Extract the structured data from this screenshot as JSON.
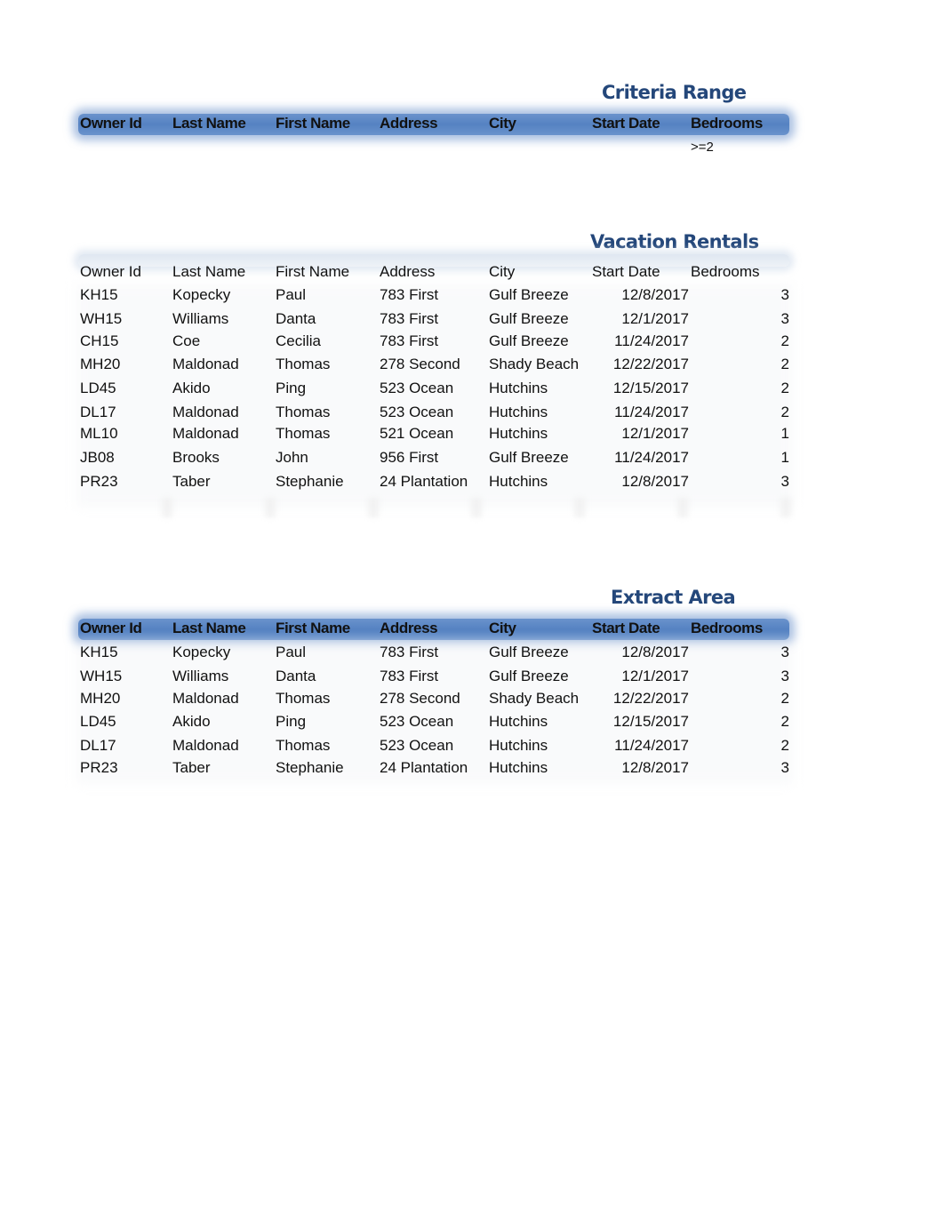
{
  "columns": [
    "Owner Id",
    "Last Name",
    "First Name",
    "Address",
    "City",
    "Start Date",
    "Bedrooms"
  ],
  "criteria": {
    "title": "Criteria Range",
    "values": [
      "",
      "",
      "",
      "",
      "",
      "",
      ">=2"
    ]
  },
  "rentals": {
    "title": "Vacation Rentals",
    "rows": [
      [
        "KH15",
        "Kopecky",
        "Paul",
        "783 First",
        "Gulf Breeze",
        "12/8/2017",
        "3"
      ],
      [
        "WH15",
        "Williams",
        "Danta",
        "783 First",
        "Gulf Breeze",
        "12/1/2017",
        "3"
      ],
      [
        "CH15",
        "Coe",
        "Cecilia",
        "783 First",
        "Gulf Breeze",
        "11/24/2017",
        "2"
      ],
      [
        "MH20",
        "Maldonad",
        "Thomas",
        "278 Second",
        "Shady Beach",
        "12/22/2017",
        "2"
      ],
      [
        "LD45",
        "Akido",
        "Ping",
        "523 Ocean",
        "Hutchins",
        "12/15/2017",
        "2"
      ],
      [
        "DL17",
        "Maldonad",
        "Thomas",
        "523 Ocean",
        "Hutchins",
        "11/24/2017",
        "2"
      ],
      [
        "ML10",
        "Maldonad",
        "Thomas",
        "521 Ocean",
        "Hutchins",
        "12/1/2017",
        "1"
      ],
      [
        "JB08",
        "Brooks",
        "John",
        "956 First",
        "Gulf Breeze",
        "11/24/2017",
        "1"
      ],
      [
        "PR23",
        "Taber",
        "Stephanie",
        "24 Plantation",
        "Hutchins",
        "12/8/2017",
        "3"
      ]
    ]
  },
  "extract": {
    "title": "Extract Area",
    "rows": [
      [
        "KH15",
        "Kopecky",
        "Paul",
        "783 First",
        "Gulf Breeze",
        "12/8/2017",
        "3"
      ],
      [
        "WH15",
        "Williams",
        "Danta",
        "783 First",
        "Gulf Breeze",
        "12/1/2017",
        "3"
      ],
      [
        "MH20",
        "Maldonad",
        "Thomas",
        "278 Second",
        "Shady Beach",
        "12/22/2017",
        "2"
      ],
      [
        "LD45",
        "Akido",
        "Ping",
        "523 Ocean",
        "Hutchins",
        "12/15/2017",
        "2"
      ],
      [
        "DL17",
        "Maldonad",
        "Thomas",
        "523 Ocean",
        "Hutchins",
        "11/24/2017",
        "2"
      ],
      [
        "PR23",
        "Taber",
        "Stephanie",
        "24 Plantation",
        "Hutchins",
        "12/8/2017",
        "3"
      ]
    ]
  }
}
